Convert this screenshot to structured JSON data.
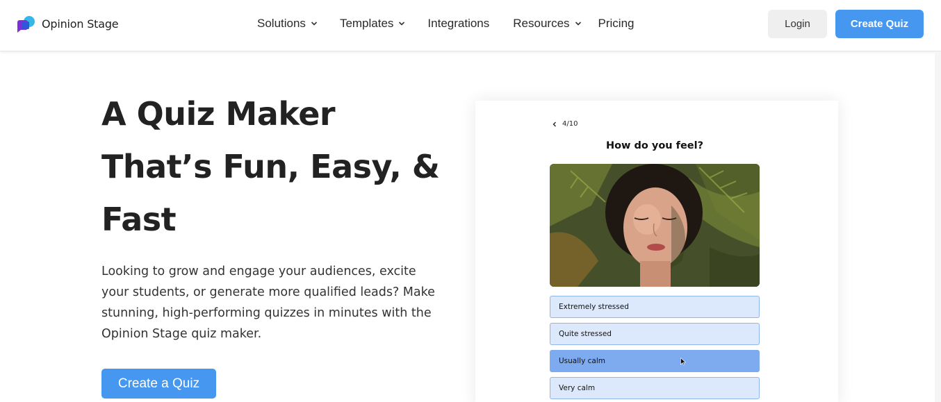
{
  "brand": {
    "name": "Opinion Stage",
    "colors": {
      "accent": "#4597f0",
      "logo_cyan": "#36b7ea",
      "logo_purple": "#7b2fd9",
      "logo_blue": "#2f57d6"
    }
  },
  "nav": {
    "items": [
      {
        "label": "Solutions",
        "has_dropdown": true
      },
      {
        "label": "Templates",
        "has_dropdown": true
      },
      {
        "label": "Integrations",
        "has_dropdown": false
      },
      {
        "label": "Resources",
        "has_dropdown": true
      },
      {
        "label": "Pricing",
        "has_dropdown": false
      }
    ],
    "login_label": "Login",
    "create_label": "Create Quiz"
  },
  "hero": {
    "title_lines": [
      "A Quiz Maker",
      "That’s Fun, Easy, &",
      "Fast"
    ],
    "description": "Looking to grow and engage your audiences, excite your students, or generate more qualified leads? Make stunning, high-performing quizzes in minutes with the Opinion Stage quiz maker.",
    "cta_label": "Create a Quiz"
  },
  "quiz_preview": {
    "progress": "4/10",
    "question": "How do you feel?",
    "image_icon": "woman-portrait-foliage-photo",
    "answers": [
      {
        "label": "Extremely stressed",
        "selected": false
      },
      {
        "label": "Quite stressed",
        "selected": false
      },
      {
        "label": "Usually calm",
        "selected": true
      },
      {
        "label": "Very calm",
        "selected": false
      }
    ]
  }
}
